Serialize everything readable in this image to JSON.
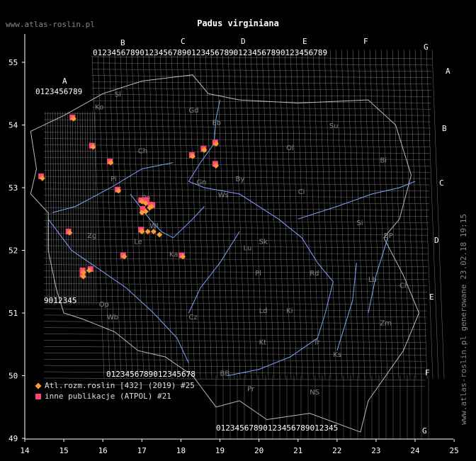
{
  "header": {
    "site": "www.atlas-roslin.pl",
    "title": "Padus virginiana",
    "generated": "www.atlas-roslin.pl generowane 23.02.18 19:15"
  },
  "colors": {
    "atl": "#ff9933",
    "inne": "#ff4477",
    "river": "#7aa6ff",
    "grid": "#777777"
  },
  "axes": {
    "lon_ticks": [
      "14",
      "15",
      "16",
      "17",
      "18",
      "19",
      "20",
      "21",
      "22",
      "23",
      "24",
      "25"
    ],
    "lat_ticks": [
      "55",
      "54",
      "53",
      "52",
      "51",
      "50",
      "49"
    ]
  },
  "grid_letters_top": [
    "A",
    "B",
    "C",
    "D",
    "E",
    "F",
    "G"
  ],
  "grid_letters_right": [
    "A",
    "B",
    "C",
    "D",
    "E",
    "F",
    "G"
  ],
  "regions": [
    "Sl",
    "Gd",
    "Eb",
    "Ko",
    "Su",
    "Ol",
    "Ch",
    "Pi",
    "Bi",
    "Ci",
    "Gn",
    "Ws",
    "Sk",
    "By",
    "Po",
    "Wl",
    "Si",
    "BP",
    "Zg",
    "Le",
    "Lu",
    "Ka",
    "Pl",
    "Rd",
    "Lb",
    "Ch",
    "Ld",
    "Op",
    "Wb",
    "Cz",
    "Ki",
    "Kt",
    "Tr",
    "Zm",
    "Ks",
    "BB",
    "Pr",
    "NS"
  ],
  "legend": [
    {
      "label": "Atl.rozm.roslin [432] (2019) #25",
      "icon": "diamond-icon"
    },
    {
      "label": "inne publikacje (ATPOL) #21",
      "icon": "square-icon"
    }
  ],
  "chart_data": {
    "type": "scatter",
    "title": "Padus virginiana",
    "xlim": [
      14,
      25
    ],
    "ylim": [
      49,
      55.5
    ],
    "series": [
      {
        "name": "Atl.rozm.roslin [432] (2019) #25",
        "marker": "diamond",
        "points": [
          [
            15.25,
            54.1
          ],
          [
            15.75,
            53.65
          ],
          [
            16.2,
            53.4
          ],
          [
            16.4,
            52.95
          ],
          [
            17.0,
            52.78
          ],
          [
            17.1,
            52.75
          ],
          [
            17.25,
            52.7
          ],
          [
            17.0,
            52.6
          ],
          [
            17.1,
            52.62
          ],
          [
            17.0,
            52.3
          ],
          [
            17.15,
            52.3
          ],
          [
            17.3,
            52.3
          ],
          [
            17.45,
            52.25
          ],
          [
            18.3,
            53.5
          ],
          [
            18.6,
            53.6
          ],
          [
            18.9,
            53.7
          ],
          [
            18.9,
            53.35
          ],
          [
            14.45,
            53.15
          ],
          [
            15.15,
            52.28
          ],
          [
            16.55,
            51.9
          ],
          [
            18.05,
            51.9
          ],
          [
            15.5,
            51.65
          ],
          [
            15.65,
            51.68
          ],
          [
            15.5,
            51.58
          ],
          [
            17.2,
            52.68
          ]
        ]
      },
      {
        "name": "inne publikacje (ATPOL) #21",
        "marker": "square",
        "points": [
          [
            15.22,
            54.12
          ],
          [
            15.72,
            53.67
          ],
          [
            16.18,
            53.42
          ],
          [
            16.38,
            52.97
          ],
          [
            16.98,
            52.8
          ],
          [
            17.12,
            52.8
          ],
          [
            17.27,
            52.72
          ],
          [
            17.02,
            52.66
          ],
          [
            16.98,
            52.33
          ],
          [
            18.28,
            53.52
          ],
          [
            18.58,
            53.62
          ],
          [
            18.88,
            53.72
          ],
          [
            18.88,
            53.38
          ],
          [
            14.42,
            53.18
          ],
          [
            15.12,
            52.3
          ],
          [
            16.52,
            51.92
          ],
          [
            18.02,
            51.92
          ],
          [
            15.48,
            51.68
          ],
          [
            15.68,
            51.7
          ],
          [
            15.48,
            51.62
          ],
          [
            17.22,
            52.73
          ]
        ]
      }
    ]
  }
}
